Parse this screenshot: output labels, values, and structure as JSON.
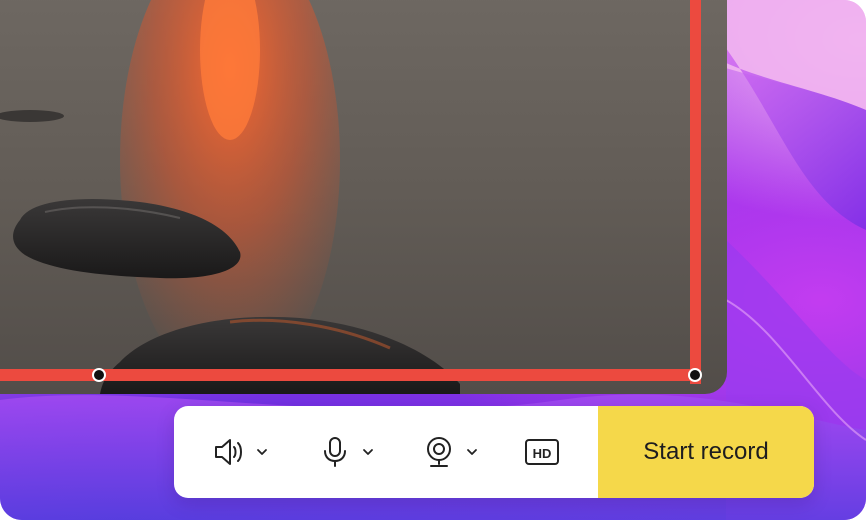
{
  "capture_area": {
    "frame_color": "#ec4a3f",
    "handle_color": "#111111"
  },
  "toolbar": {
    "items": [
      {
        "icon": "speaker-icon",
        "has_dropdown": true
      },
      {
        "icon": "microphone-icon",
        "has_dropdown": true
      },
      {
        "icon": "webcam-icon",
        "has_dropdown": true
      },
      {
        "icon": "hd-icon",
        "label": "HD",
        "has_dropdown": false
      }
    ],
    "start_label": "Start record",
    "start_color": "#f5d84a"
  }
}
